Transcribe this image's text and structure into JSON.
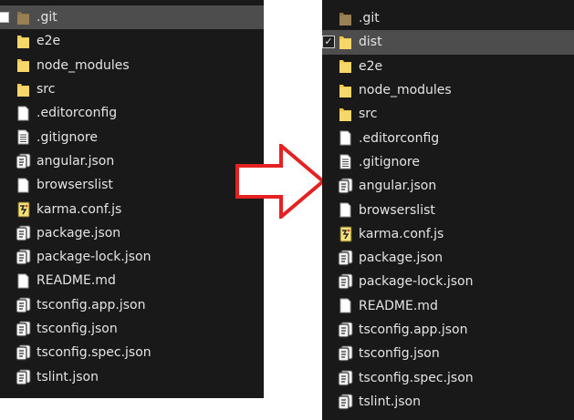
{
  "left_panel": {
    "items": [
      {
        "label": ".git",
        "icon": "folder-git-icon",
        "selected": true
      },
      {
        "label": "e2e",
        "icon": "folder-icon"
      },
      {
        "label": "node_modules",
        "icon": "folder-icon"
      },
      {
        "label": "src",
        "icon": "folder-icon"
      },
      {
        "label": ".editorconfig",
        "icon": "blank-file-icon"
      },
      {
        "label": ".gitignore",
        "icon": "text-file-icon"
      },
      {
        "label": "angular.json",
        "icon": "json-file-icon"
      },
      {
        "label": "browserslist",
        "icon": "blank-file-icon"
      },
      {
        "label": "karma.conf.js",
        "icon": "js-file-icon"
      },
      {
        "label": "package.json",
        "icon": "json-file-icon"
      },
      {
        "label": "package-lock.json",
        "icon": "json-file-icon"
      },
      {
        "label": "README.md",
        "icon": "blank-file-icon"
      },
      {
        "label": "tsconfig.app.json",
        "icon": "json-file-icon"
      },
      {
        "label": "tsconfig.json",
        "icon": "json-file-icon"
      },
      {
        "label": "tsconfig.spec.json",
        "icon": "json-file-icon"
      },
      {
        "label": "tslint.json",
        "icon": "json-file-icon"
      }
    ]
  },
  "right_panel": {
    "items": [
      {
        "label": ".git",
        "icon": "folder-git-icon"
      },
      {
        "label": "dist",
        "icon": "folder-icon",
        "selected": true,
        "checked": true
      },
      {
        "label": "e2e",
        "icon": "folder-icon"
      },
      {
        "label": "node_modules",
        "icon": "folder-icon"
      },
      {
        "label": "src",
        "icon": "folder-icon"
      },
      {
        "label": ".editorconfig",
        "icon": "blank-file-icon"
      },
      {
        "label": ".gitignore",
        "icon": "text-file-icon"
      },
      {
        "label": "angular.json",
        "icon": "json-file-icon"
      },
      {
        "label": "browserslist",
        "icon": "blank-file-icon"
      },
      {
        "label": "karma.conf.js",
        "icon": "js-file-icon"
      },
      {
        "label": "package.json",
        "icon": "json-file-icon"
      },
      {
        "label": "package-lock.json",
        "icon": "json-file-icon"
      },
      {
        "label": "README.md",
        "icon": "blank-file-icon"
      },
      {
        "label": "tsconfig.app.json",
        "icon": "json-file-icon"
      },
      {
        "label": "tsconfig.json",
        "icon": "json-file-icon"
      },
      {
        "label": "tsconfig.spec.json",
        "icon": "json-file-icon"
      },
      {
        "label": "tslint.json",
        "icon": "json-file-icon"
      }
    ]
  },
  "colors": {
    "panel_bg": "#191919",
    "selected_row": "#4d4d4d",
    "text": "#e4e4e4",
    "folder": "#f3c94d",
    "folder_git": "#8c7449",
    "arrow": "#e52222"
  }
}
